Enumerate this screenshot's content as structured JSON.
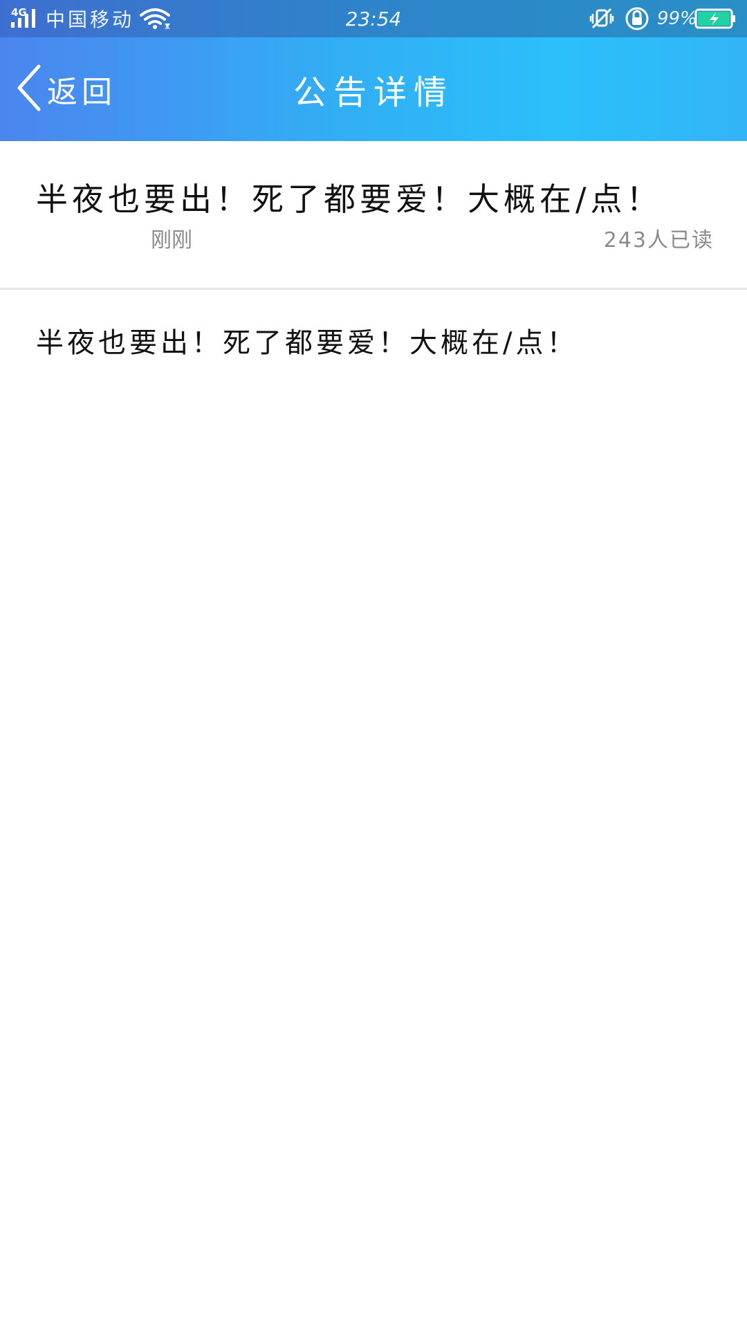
{
  "status_bar": {
    "network_type": "4G",
    "carrier": "中国移动",
    "time": "23:54",
    "battery_percent": "99%",
    "icons": [
      "signal-icon",
      "wifi-icon",
      "vibrate-off-icon",
      "rotation-lock-icon",
      "battery-charging-icon"
    ],
    "battery_color": "#20d3a0"
  },
  "header": {
    "back_label": "返回",
    "title": "公告详情",
    "back_icon": "chevron-left-icon",
    "gradient_colors": [
      "#4b85ee",
      "#2bc0fa"
    ]
  },
  "notice": {
    "title": "半夜也要出！死了都要爱！大概在/点！",
    "time": "刚刚",
    "read_count": "243人已读",
    "body": "半夜也要出！死了都要爱！大概在/点！"
  }
}
